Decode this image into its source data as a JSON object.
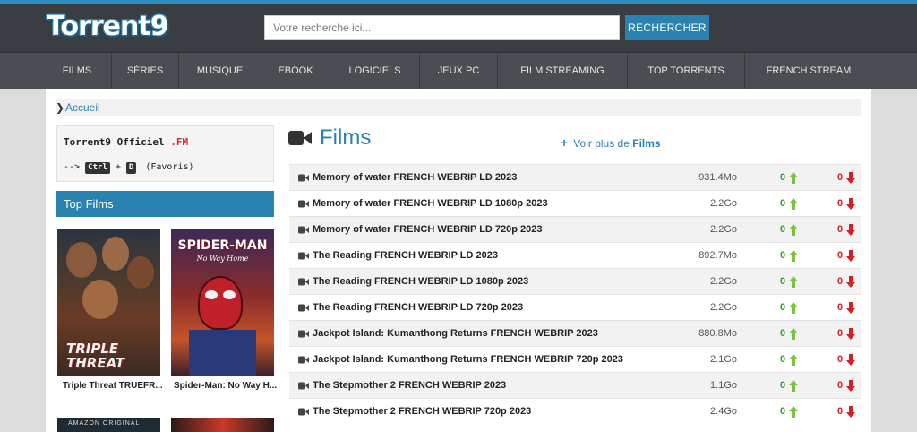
{
  "header": {
    "logo": "Torrent9",
    "search_placeholder": "Votre recherche ici...",
    "search_button": "RECHERCHER"
  },
  "nav": [
    {
      "label": "FILMS"
    },
    {
      "label": "SÉRIES"
    },
    {
      "label": "MUSIQUE"
    },
    {
      "label": "EBOOK"
    },
    {
      "label": "LOGICIELS"
    },
    {
      "label": "JEUX PC"
    },
    {
      "label": "FILM STREAMING"
    },
    {
      "label": "TOP TORRENTS"
    },
    {
      "label": "FRENCH STREAM"
    }
  ],
  "breadcrumb": {
    "home": "Accueil"
  },
  "sidebar": {
    "official_title": "Torrent9 Officiel",
    "official_tld": ".FM",
    "shortcut_prefix": "-->",
    "shortcut_key1": "Ctrl",
    "shortcut_plus": "+",
    "shortcut_key2": "D",
    "shortcut_suffix": "(Favoris)",
    "top_films_title": "Top Films",
    "posters": [
      {
        "title_line1": "TRIPLE",
        "title_line2": "THREAT",
        "caption": "Triple Threat TRUEFR..."
      },
      {
        "title_line1": "SPIDER-MAN",
        "title_line2": "No Way Home",
        "caption": "Spider-Man: No Way H..."
      },
      {
        "banner": "AMAZON ORIGINAL"
      }
    ]
  },
  "films": {
    "title": "Films",
    "see_more_prefix": "Voir plus de",
    "see_more_bold": "Films",
    "colors": {
      "accent": "#2a82b0",
      "seed": "#2e9a2e",
      "leech": "#d42020"
    },
    "rows": [
      {
        "name": "Memory of water FRENCH WEBRIP LD 2023",
        "size": "931.4Mo",
        "seeders": "0",
        "leechers": "0"
      },
      {
        "name": "Memory of water FRENCH WEBRIP LD 1080p 2023",
        "size": "2.2Go",
        "seeders": "0",
        "leechers": "0"
      },
      {
        "name": "Memory of water FRENCH WEBRIP LD 720p 2023",
        "size": "2.2Go",
        "seeders": "0",
        "leechers": "0"
      },
      {
        "name": "The Reading FRENCH WEBRIP LD 2023",
        "size": "892.7Mo",
        "seeders": "0",
        "leechers": "0"
      },
      {
        "name": "The Reading FRENCH WEBRIP LD 1080p 2023",
        "size": "2.2Go",
        "seeders": "0",
        "leechers": "0"
      },
      {
        "name": "The Reading FRENCH WEBRIP LD 720p 2023",
        "size": "2.2Go",
        "seeders": "0",
        "leechers": "0"
      },
      {
        "name": "Jackpot Island: Kumanthong Returns FRENCH WEBRIP 2023",
        "size": "880.8Mo",
        "seeders": "0",
        "leechers": "0"
      },
      {
        "name": "Jackpot Island: Kumanthong Returns FRENCH WEBRIP 720p 2023",
        "size": "2.1Go",
        "seeders": "0",
        "leechers": "0"
      },
      {
        "name": "The Stepmother 2 FRENCH WEBRIP 2023",
        "size": "1.1Go",
        "seeders": "0",
        "leechers": "0"
      },
      {
        "name": "The Stepmother 2 FRENCH WEBRIP 720p 2023",
        "size": "2.4Go",
        "seeders": "0",
        "leechers": "0"
      }
    ]
  }
}
